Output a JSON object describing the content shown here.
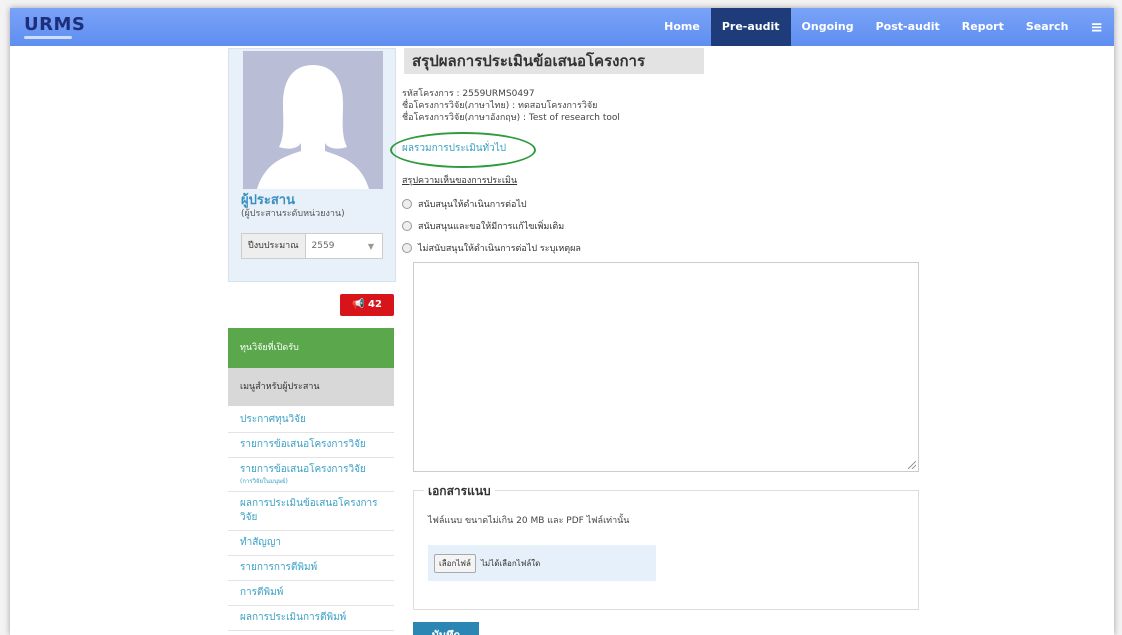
{
  "app": {
    "logo": "URMS"
  },
  "nav": {
    "items": [
      {
        "label": "Home"
      },
      {
        "label": "Pre-audit"
      },
      {
        "label": "Ongoing"
      },
      {
        "label": "Post-audit"
      },
      {
        "label": "Report"
      },
      {
        "label": "Search"
      }
    ],
    "menu_icon": "≡"
  },
  "profile": {
    "role_title": "ผู้ประสาน",
    "role_sub": "(ผู้ประสานระดับหน่วยงาน)",
    "budget_label": "ปีงบประมาณ",
    "budget_value": "2559"
  },
  "sidebar": {
    "badge": "42",
    "green_menu": "ทุนวิจัยที่เปิดรับ",
    "grey_menu": "เมนูสำหรับผู้ประสาน",
    "links": [
      {
        "label": "ประกาศทุนวิจัย"
      },
      {
        "label": "รายการข้อเสนอโครงการวิจัย"
      },
      {
        "label": "รายการข้อเสนอโครงการวิจัย",
        "sub": "(การวิจัยในมนุษย์)"
      },
      {
        "label": "ผลการประเมินข้อเสนอโครงการวิจัย"
      },
      {
        "label": "ทำสัญญา"
      },
      {
        "label": "รายการการตีพิมพ์"
      },
      {
        "label": "การตีพิมพ์"
      },
      {
        "label": "ผลการประเมินการตีพิมพ์"
      }
    ]
  },
  "main": {
    "title": "สรุปผลการประเมินข้อเสนอโครงการ",
    "project_code": "รหัสโครงการ : 2559URMS0497",
    "project_name_th": "ชื่อโครงการวิจัย(ภาษาไทย) : ทดสอบโครงการวิจัย",
    "project_name_en": "ชื่อโครงการวิจัย(ภาษาอังกฤษ) : Test of research tool",
    "overall_link": "ผลรวมการประเมินทั่วไป",
    "summary_head": "สรุปความเห็นของการประเมิน",
    "options": [
      {
        "label": "สนับสนุนให้ดำเนินการต่อไป"
      },
      {
        "label": "สนับสนุนและขอให้มีการแก้ไขเพิ่มเติม"
      },
      {
        "label": "ไม่สนับสนุนให้ดำเนินการต่อไป ระบุเหตุผล"
      }
    ],
    "attachment_legend": "เอกสารแนบ",
    "attachment_note": "ไฟล์แนบ ขนาดไม่เกิน 20 MB และ PDF ไฟล์เท่านั้น",
    "file_button": "เลือกไฟล์",
    "file_status": "ไม่ได้เลือกไฟล์ใด",
    "save_label": "บันทึก"
  },
  "colors": {
    "nav": "#6e9af5",
    "nav_active": "#1f3c7a",
    "green_menu": "#5ba84c",
    "badge": "#d7141a",
    "link": "#3aa0c4",
    "save": "#2c86b3"
  }
}
